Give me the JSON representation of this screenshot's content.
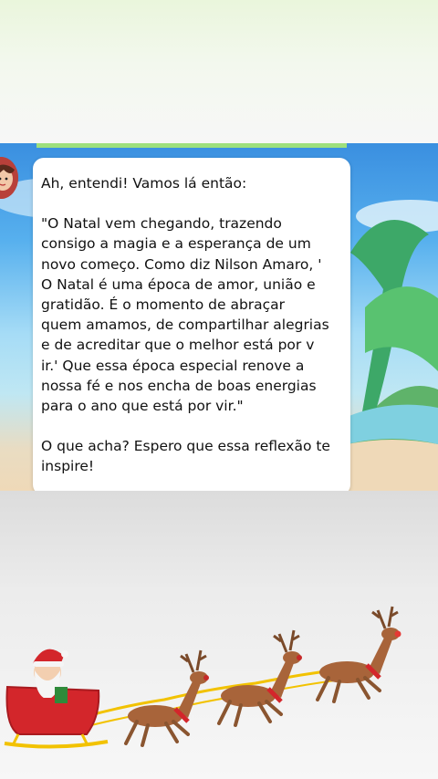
{
  "chat": {
    "message_paragraphs": [
      "Ah, entendi! Vamos lá então:",
      "\"O Natal vem chegando, trazendo\nconsigo a magia e a esperança de um\nnovo começo. Como diz Nilson Amaro, '\nO Natal é uma época de amor, união e\ngratidão. É o momento de abraçar\nquem amamos, de compartilhar alegrias\ne de acreditar que o melhor está por v\nir.' Que essa época especial renove a\nnossa fé e nos encha de boas energias\npara o ano que está por vir.\"",
      "O que acha? Espero que essa reflexão te\ninspire!"
    ]
  },
  "icons": {
    "avatar": "avatar-icon",
    "santa": "santa-sleigh-icon",
    "reindeer": "reindeer-icon"
  },
  "colors": {
    "sky_top": "#3a8fe0",
    "sky_mid": "#a6dcf6",
    "sand": "#efd9b8",
    "bubble": "#ffffff",
    "sleigh_red": "#d3262b",
    "reindeer_brown": "#a8643a"
  }
}
